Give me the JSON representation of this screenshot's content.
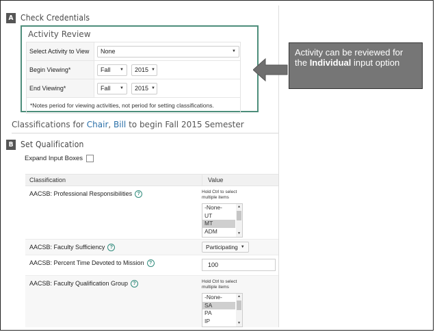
{
  "credentials": {
    "badge": "A",
    "title": "Check Credentials",
    "activity_review": {
      "title": "Activity Review",
      "rows": [
        {
          "label": "Select Activity to View",
          "value": "None"
        },
        {
          "label": "Begin Viewing*",
          "term": "Fall",
          "year": "2015"
        },
        {
          "label": "End Viewing*",
          "term": "Fall",
          "year": "2015"
        }
      ],
      "note": "*Notes period for viewing activities, not period for setting classifications."
    }
  },
  "classifications": {
    "prefix": "Classifications for ",
    "person_last": "Chair",
    "separator": ", ",
    "person_first": "Bill",
    "suffix": " to begin Fall 2015 Semester"
  },
  "qualification": {
    "badge": "B",
    "title": "Set Qualification",
    "expand_label": "Expand Input Boxes",
    "col_classification": "Classification",
    "col_value": "Value",
    "rows": [
      {
        "label": "AACSB: Professional Responsibilities",
        "hint": "Hold Ctrl to select multiple items",
        "options": [
          "-None-",
          "UT",
          "MT",
          "ADM"
        ],
        "selected": "MT"
      },
      {
        "label": "AACSB: Faculty Sufficiency",
        "value": "Participating"
      },
      {
        "label": "AACSB: Percent Time Devoted to Mission",
        "value": "100"
      },
      {
        "label": "AACSB: Faculty Qualification Group",
        "hint": "Hold Ctrl to select multiple items",
        "options": [
          "-None-",
          "SA",
          "PA",
          "IP"
        ],
        "selected": "SA"
      }
    ]
  },
  "callout": {
    "text_before": "Activity can be reviewed for the ",
    "text_bold": "Individual",
    "text_after": " input option"
  },
  "colors": {
    "highlight_border": "#4c8d7a",
    "link": "#2a6fa8",
    "callout_bg": "#767676",
    "arrow": "#6f6f6f"
  }
}
